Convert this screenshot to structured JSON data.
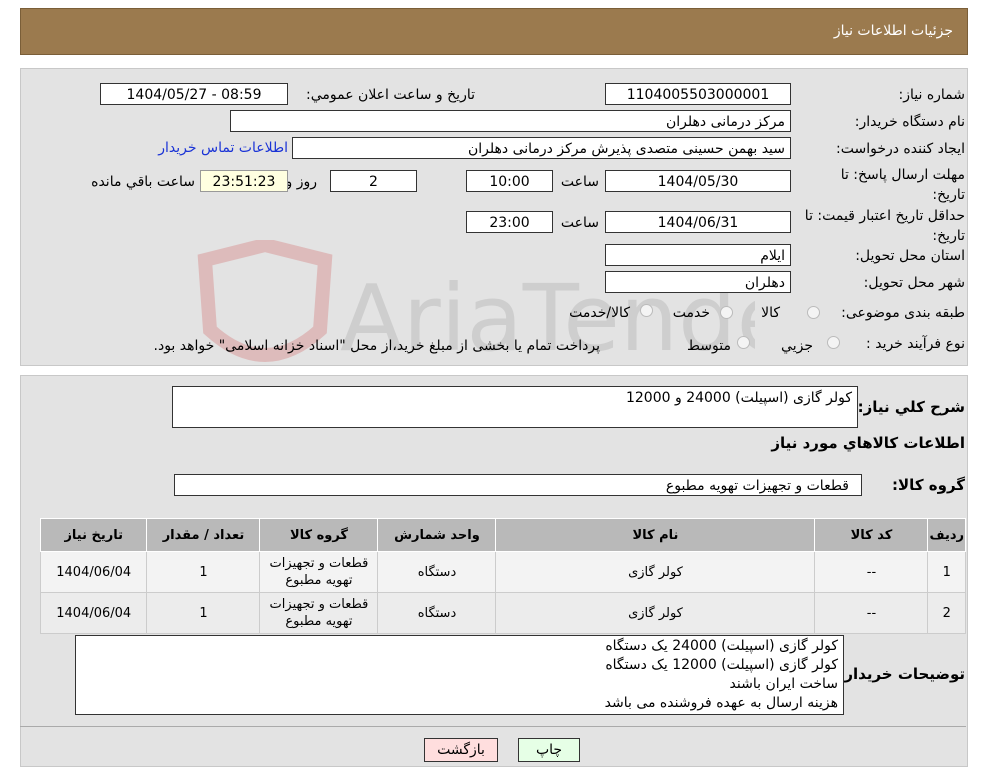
{
  "header": {
    "title": "جزئیات اطلاعات نیاز"
  },
  "form": {
    "need_number_label": "شماره نیاز:",
    "need_number": "1104005503000001",
    "announce_label": "تاریخ و ساعت اعلان عمومي:",
    "announce_value": "1404/05/27 - 08:59",
    "buyer_org_label": "نام دستگاه خريدار:",
    "buyer_org": "مرکز درمانی دهلران",
    "creator_label": "ايجاد کننده درخواست:",
    "creator": "سید بهمن حسینی متصدی پذیرش مرکز درمانی دهلران",
    "contact_link": "اطلاعات تماس خريدار",
    "deadline_label": "مهلت ارسال پاسخ: تا تاریخ:",
    "deadline_date": "1404/05/30",
    "hour_label": "ساعت",
    "deadline_time": "10:00",
    "days": "2",
    "days_label": "روز و",
    "remaining": "23:51:23",
    "remaining_label": "ساعت باقي مانده",
    "validity_label": "حداقل تاریخ اعتبار قیمت: تا تاریخ:",
    "validity_date": "1404/06/31",
    "validity_time": "23:00",
    "province_label": "استان محل تحويل:",
    "province": "ایلام",
    "city_label": "شهر محل تحويل:",
    "city": "دهلران",
    "category_label": "طبقه بندی موضوعی:",
    "category_options": [
      "کالا",
      "خدمت",
      "کالا/خدمت"
    ],
    "process_label": "نوع فرآيند خريد :",
    "process_options": [
      "جزيي",
      "متوسط"
    ],
    "process_note": "پرداخت تمام یا بخشی از مبلغ خرید،از محل \"اسناد خزانه اسلامی\" خواهد بود."
  },
  "details": {
    "summary_label": "شرح کلي نياز:",
    "summary": "کولر گازی (اسپیلت) 24000 و 12000",
    "goods_info_title": "اطلاعات کالاهاي مورد نياز",
    "group_label": "گروه کالا:",
    "group": "قطعات و تجهیزات تهویه مطبوع",
    "table": {
      "headers": [
        "رديف",
        "کد کالا",
        "نام کالا",
        "واحد شمارش",
        "گروه کالا",
        "تعداد / مقدار",
        "تاريخ نياز"
      ],
      "rows": [
        [
          "1",
          "--",
          "کولر گازی",
          "دستگاه",
          "قطعات و تجهیزات تهویه مطبوع",
          "1",
          "1404/06/04"
        ],
        [
          "2",
          "--",
          "کولر گازی",
          "دستگاه",
          "قطعات و تجهیزات تهویه مطبوع",
          "1",
          "1404/06/04"
        ]
      ]
    },
    "buyer_notes_label": "توضيحات خريدار:",
    "buyer_notes": [
      "کولر گازی (اسپیلت) 24000  یک دستگاه",
      "کولر گازی (اسپیلت) 12000 یک دستگاه",
      "ساخت ایران باشند",
      "هزینه ارسال به عهده فروشنده می باشد"
    ]
  },
  "buttons": {
    "print": "چاپ",
    "back": "بازگشت"
  },
  "watermark": "AriaTender.neT"
}
